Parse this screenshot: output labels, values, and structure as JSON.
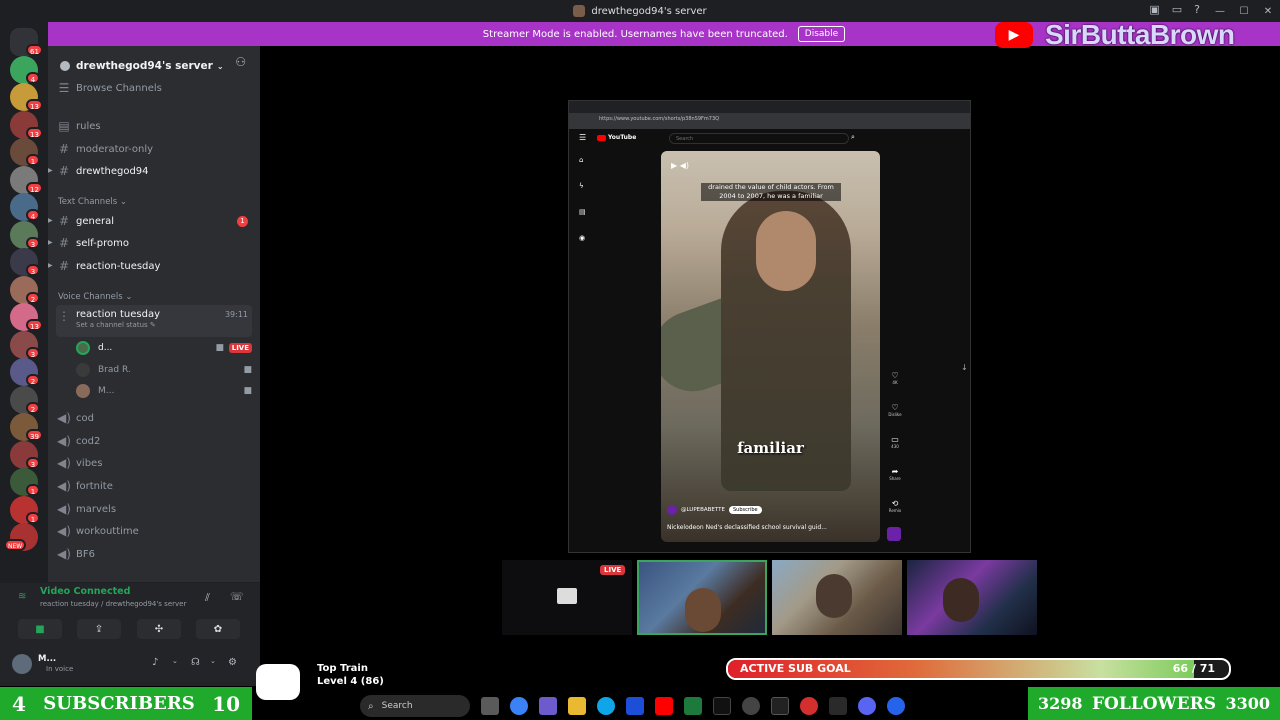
{
  "window": {
    "title": "drewthegod94's server"
  },
  "banner": {
    "text": "Streamer Mode is enabled. Usernames have been truncated.",
    "disable_label": "Disable"
  },
  "overlay": {
    "channel_name": "SirButtaBrown"
  },
  "rail_badges": [
    "61",
    "4",
    "13",
    "13",
    "1",
    "12",
    "4",
    "3",
    "3",
    "2",
    "13",
    "3",
    "2",
    "2",
    "39",
    "3",
    "1",
    "1",
    "NEW"
  ],
  "sidebar": {
    "server_name": "drewthegod94's server",
    "browse_channels": "Browse Channels",
    "top_channels": [
      "rules",
      "moderator-only",
      "drewthegod94"
    ],
    "text_category": "Text Channels",
    "text_channels": [
      {
        "name": "general",
        "unread": "1"
      },
      {
        "name": "self-promo"
      },
      {
        "name": "reaction-tuesday"
      }
    ],
    "voice_category": "Voice Channels",
    "active_voice": {
      "name": "reaction tuesday",
      "timer": "39:11",
      "status": "Set a channel status"
    },
    "voice_users": [
      {
        "name": "d...",
        "live": "LIVE"
      },
      {
        "name": "Brad R."
      },
      {
        "name": "M..."
      }
    ],
    "voice_channels": [
      "cod",
      "cod2",
      "vibes",
      "fortnite",
      "marvels",
      "workouttime",
      "BF6"
    ]
  },
  "voice_panel": {
    "status": "Video Connected",
    "location": "reaction tuesday / drewthegod94's server"
  },
  "user_panel": {
    "name": "M...",
    "status": "In voice"
  },
  "browser": {
    "url": "https://www.youtube.com/shorts/p38nS9Fm73Q",
    "search_placeholder": "Search",
    "yt_label": "YouTube",
    "caption_top": "drained the value of child actors. From 2004 to 2007, he was a familiar",
    "caption_big": "familiar",
    "channel": "@LUPEBABETTE",
    "subscribe": "Subscribe",
    "title": "Nickelodeon Ned's declassified school survival guid...",
    "actions": [
      {
        "icon": "thumbs-up",
        "label": "4K"
      },
      {
        "icon": "thumbs-down",
        "label": "Dislike"
      },
      {
        "icon": "comment",
        "label": "430"
      },
      {
        "icon": "share",
        "label": "Share"
      },
      {
        "icon": "remix",
        "label": "Remix"
      }
    ]
  },
  "cams": {
    "live_label": "LIVE"
  },
  "stream_overlay": {
    "subs_current": "4",
    "subs_label": "SUBSCRIBERS",
    "subs_goal": "10",
    "followers_current": "3298",
    "followers_label": "FOLLOWERS",
    "followers_goal": "3300",
    "hype_title": "Top Train",
    "hype_level": "Level 4 (86)",
    "sub_goal_label": "ACTIVE SUB GOAL",
    "sub_goal_count": "66 / 71",
    "sub_goal_fraction": 0.93
  },
  "taskbar": {
    "search_label": "Search"
  }
}
